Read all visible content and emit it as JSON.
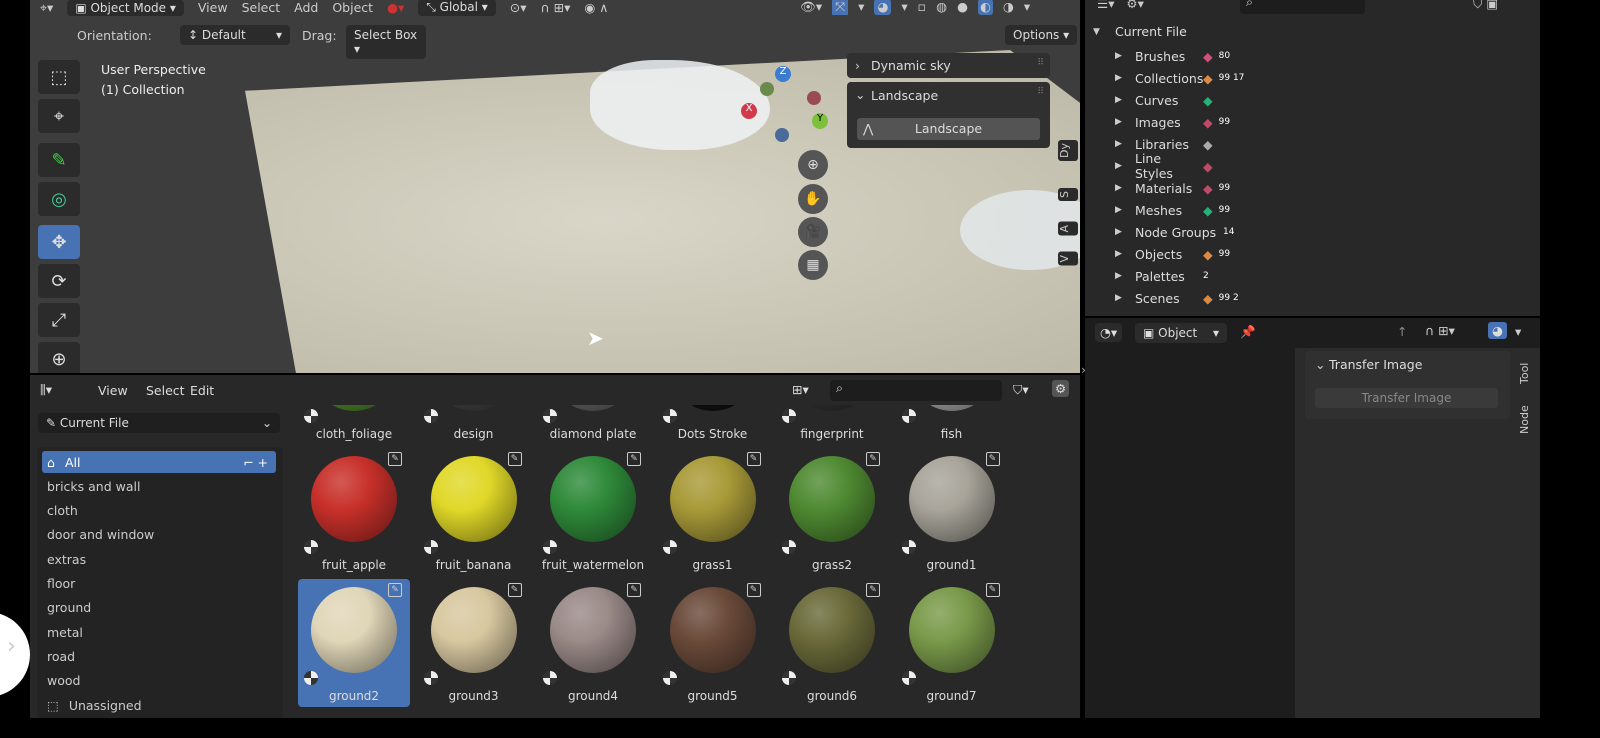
{
  "viewport": {
    "header": {
      "editor_icon": "cursor-icon",
      "mode": "Object Mode",
      "menus": [
        "View",
        "Select",
        "Add",
        "Object"
      ],
      "transform": "Global"
    },
    "toolsettings": {
      "orientation_label": "Orientation:",
      "orientation": "Default",
      "drag_label": "Drag:",
      "drag": "Select Box",
      "options": "Options"
    },
    "perspective": "User Perspective",
    "collection": "(1) Collection",
    "gizmo": {
      "x": "X",
      "y": "Y",
      "z": "Z"
    },
    "panels": {
      "dynamic_sky": "Dynamic sky",
      "landscape": "Landscape",
      "landscape_button": "Landscape"
    },
    "side_tabs": [
      "Dy",
      "S",
      "A",
      "V"
    ]
  },
  "outliner": {
    "root": "Current File",
    "items": [
      {
        "label": "Brushes",
        "badge": "80",
        "color": "#d0507a"
      },
      {
        "label": "Collections",
        "badge": "99 17",
        "color": "#d98a45"
      },
      {
        "label": "Curves",
        "badge": "",
        "color": "#29b07a"
      },
      {
        "label": "Images",
        "badge": "99",
        "color": "#c04a6a"
      },
      {
        "label": "Libraries",
        "badge": "",
        "color": "#aaaaaa"
      },
      {
        "label": "Line Styles",
        "badge": "",
        "color": "#c04a6a"
      },
      {
        "label": "Materials",
        "badge": "99",
        "color": "#c04a6a"
      },
      {
        "label": "Meshes",
        "badge": "99",
        "color": "#29b07a"
      },
      {
        "label": "Node Groups",
        "badge": "14",
        "color": ""
      },
      {
        "label": "Objects",
        "badge": "99",
        "color": "#d98a45"
      },
      {
        "label": "Palettes",
        "badge": "2",
        "color": ""
      },
      {
        "label": "Scenes",
        "badge": "99 2",
        "color": "#d98a45"
      }
    ]
  },
  "node_editor": {
    "object_type": "Object",
    "panel_title": "Transfer Image",
    "panel_button": "Transfer Image",
    "tabs": [
      "Tool",
      "Node"
    ]
  },
  "asset_browser": {
    "menus": [
      "View",
      "Select",
      "Edit"
    ],
    "library": "Current File",
    "search_placeholder": "",
    "categories": [
      "All",
      "bricks and wall",
      "cloth",
      "door and window",
      "extras",
      "floor",
      "ground",
      "metal",
      "road",
      "wood",
      "Unassigned"
    ],
    "selected_category": "All",
    "assets": [
      {
        "name": "cloth_foliage",
        "color": "#4f8a2a"
      },
      {
        "name": "design",
        "color": "#444"
      },
      {
        "name": "diamond plate",
        "color": "#666"
      },
      {
        "name": "Dots Stroke",
        "color": "#111"
      },
      {
        "name": "fingerprint",
        "color": "#333"
      },
      {
        "name": "fish",
        "color": "#aaa"
      },
      {
        "name": "fruit_apple",
        "color": "#c8302a"
      },
      {
        "name": "fruit_banana",
        "color": "#e0d828"
      },
      {
        "name": "fruit_watermelon",
        "color": "#2f8a3a"
      },
      {
        "name": "grass1",
        "color": "#a89a38"
      },
      {
        "name": "grass2",
        "color": "#4f8a32"
      },
      {
        "name": "ground1",
        "color": "#a8a49a"
      },
      {
        "name": "ground2",
        "color": "#e0d6b8"
      },
      {
        "name": "ground3",
        "color": "#d8c8a0"
      },
      {
        "name": "ground4",
        "color": "#9a8a88"
      },
      {
        "name": "ground5",
        "color": "#6a4a3a"
      },
      {
        "name": "ground6",
        "color": "#6a6a3a"
      },
      {
        "name": "ground7",
        "color": "#7a9a4a"
      }
    ],
    "selected_asset": "ground2"
  }
}
